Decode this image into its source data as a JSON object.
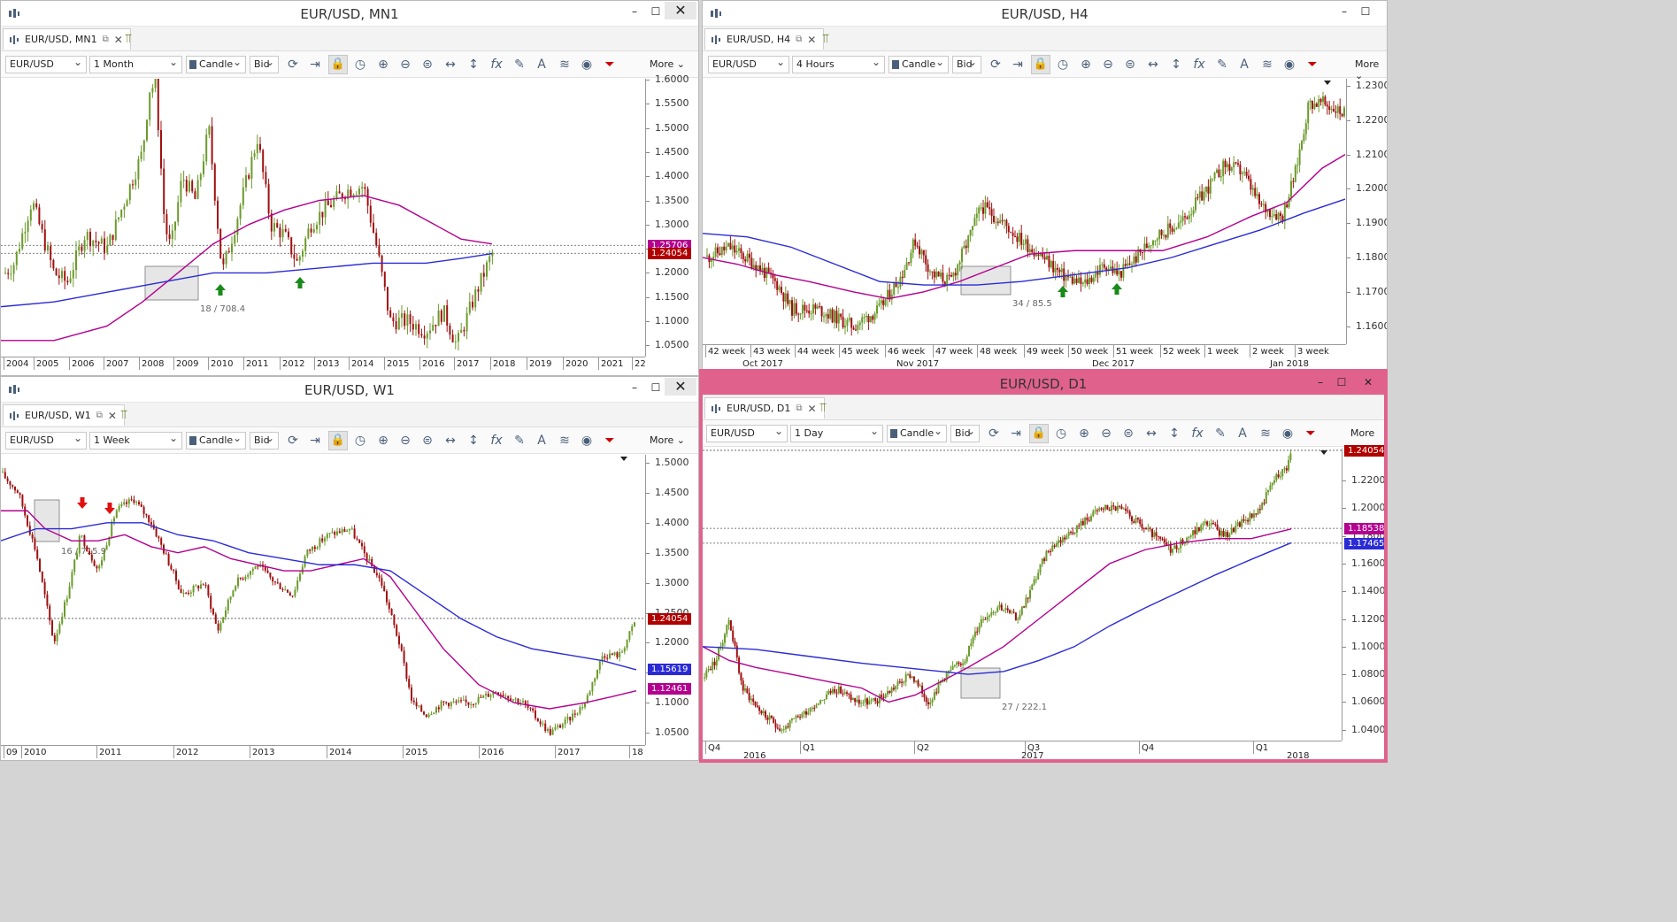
{
  "windows": {
    "mn1": {
      "title": "EUR/USD, MN1",
      "tab": "EUR/USD, MN1",
      "symbol": "EUR/USD",
      "period": "1 Month",
      "chart_type": "Candle",
      "side": "Bid",
      "more": "More",
      "prices": [
        "1.6000",
        "1.5500",
        "1.5000",
        "1.4500",
        "1.4000",
        "1.3500",
        "1.3000",
        "1.2500",
        "1.2000",
        "1.1500",
        "1.1000",
        "1.0500"
      ],
      "tags": [
        {
          "v": "1.25706",
          "c": "#b3008f"
        },
        {
          "v": "1.24054",
          "c": "#b00000"
        }
      ],
      "times": [
        "2004",
        "2005",
        "2006",
        "2007",
        "2008",
        "2009",
        "2010",
        "2011",
        "2012",
        "2013",
        "2014",
        "2015",
        "2016",
        "2017",
        "2018",
        "2019",
        "2020",
        "2021",
        "22"
      ],
      "box_label": "18 / 708.4"
    },
    "h4": {
      "title": "EUR/USD, H4",
      "tab": "EUR/USD, H4",
      "symbol": "EUR/USD",
      "period": "4 Hours",
      "chart_type": "Candle",
      "side": "Bid",
      "more": "More",
      "prices": [
        "1.2300",
        "1.2200",
        "1.2100",
        "1.2000",
        "1.1900",
        "1.1800",
        "1.1700",
        "1.1600"
      ],
      "times": [
        "42 week",
        "43 week",
        "44 week",
        "45 week",
        "46 week",
        "47 week",
        "48 week",
        "49 week",
        "50 week",
        "51 week",
        "52 week",
        "1 week",
        "2 week",
        "3 week"
      ],
      "months": [
        "Oct 2017",
        "Nov 2017",
        "Dec 2017",
        "Jan 2018"
      ],
      "box_label": "34 / 85.5"
    },
    "w1": {
      "title": "EUR/USD, W1",
      "tab": "EUR/USD, W1",
      "symbol": "EUR/USD",
      "period": "1 Week",
      "chart_type": "Candle",
      "side": "Bid",
      "more": "More",
      "prices": [
        "1.5000",
        "1.4500",
        "1.4000",
        "1.3500",
        "1.3000",
        "1.2500",
        "1.2000",
        "1.1500",
        "1.1000",
        "1.0500"
      ],
      "tags": [
        {
          "v": "1.24054",
          "c": "#b00000"
        },
        {
          "v": "1.15619",
          "c": "#2b2bd6"
        },
        {
          "v": "1.12461",
          "c": "#b3008f"
        }
      ],
      "times": [
        "09",
        "2010",
        "2011",
        "2012",
        "2013",
        "2014",
        "2015",
        "2016",
        "2017",
        "18"
      ],
      "box_label": "16 / 715.9"
    },
    "d1": {
      "title": "EUR/USD, D1",
      "tab": "EUR/USD, D1",
      "symbol": "EUR/USD",
      "period": "1 Day",
      "chart_type": "Candle",
      "side": "Bid",
      "more": "More",
      "prices": [
        "1.2200",
        "1.2000",
        "1.1800",
        "1.1600",
        "1.1400",
        "1.1200",
        "1.1000",
        "1.0800",
        "1.0600",
        "1.0400"
      ],
      "tags": [
        {
          "v": "1.24054",
          "c": "#b00000"
        },
        {
          "v": "1.18538",
          "c": "#b3008f"
        },
        {
          "v": "1.17465",
          "c": "#2b2bd6"
        }
      ],
      "quarters": [
        "Q4",
        "Q1",
        "Q2",
        "Q3",
        "Q4",
        "Q1"
      ],
      "years": [
        "2016",
        "2017",
        "2018"
      ],
      "box_label": "27 / 222.1"
    }
  }
}
